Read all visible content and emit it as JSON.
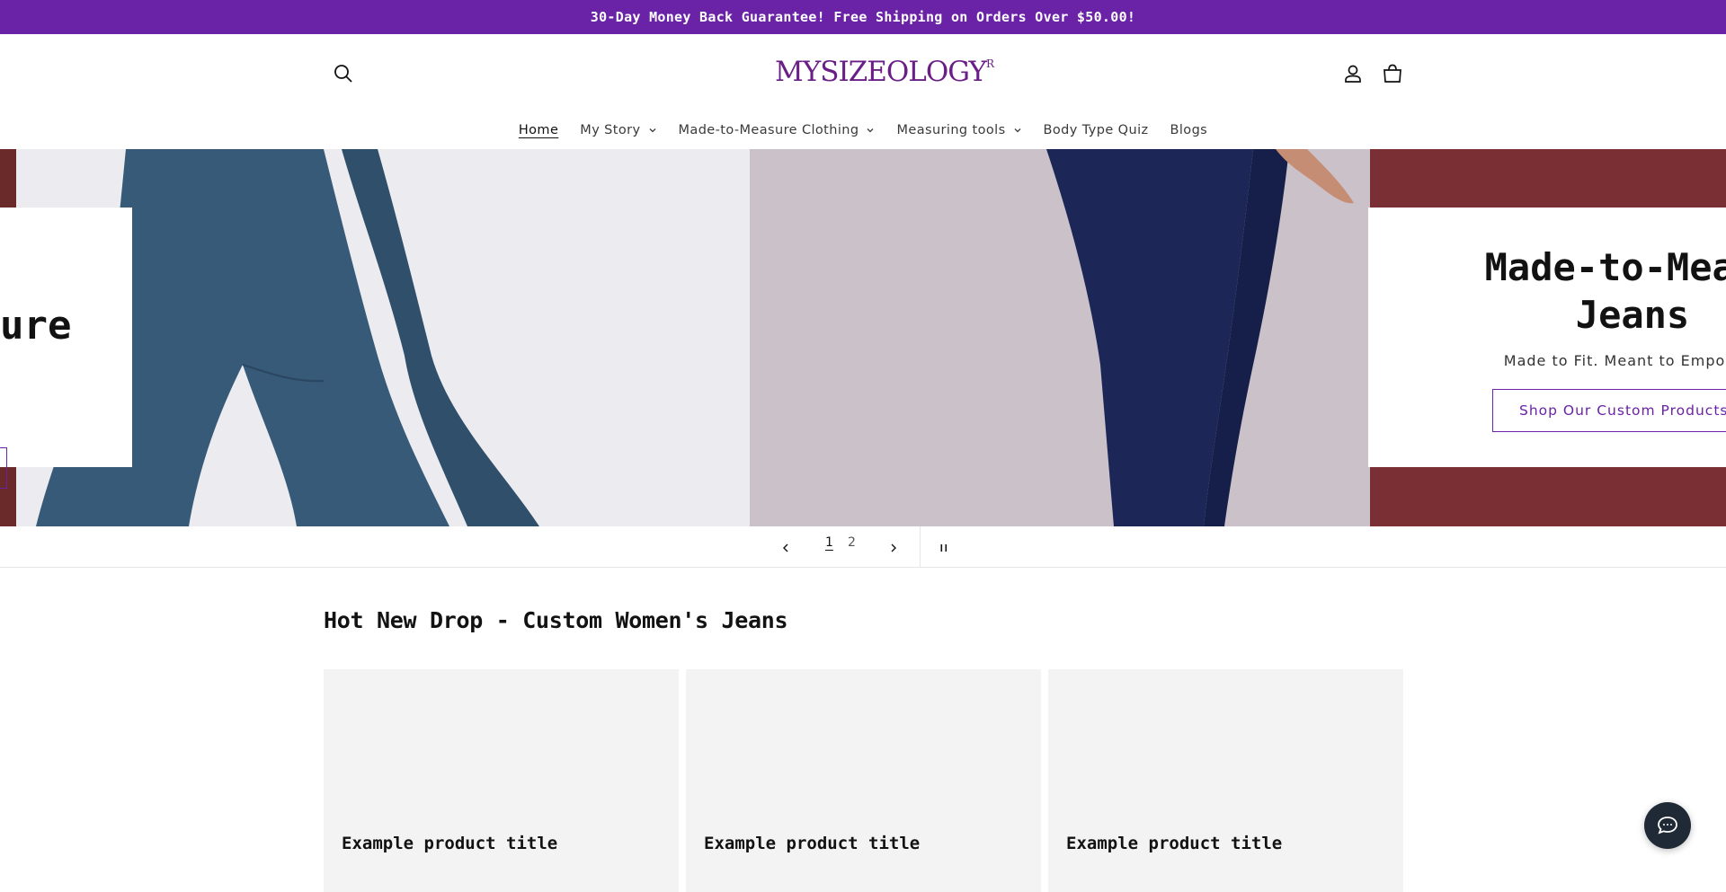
{
  "announcement": {
    "text": "30-Day Money Back Guarantee! Free Shipping on Orders Over $50.00!"
  },
  "header": {
    "logo_text": "MYSIZEOLOGY",
    "logo_mark": "R",
    "icons": {
      "search": "search-icon",
      "account": "account-icon",
      "cart": "cart-icon"
    }
  },
  "nav": {
    "items": [
      {
        "label": "Home",
        "active": true,
        "dropdown": false
      },
      {
        "label": "My Story",
        "active": false,
        "dropdown": true
      },
      {
        "label": "Made-to-Measure Clothing",
        "active": false,
        "dropdown": true
      },
      {
        "label": "Measuring tools",
        "active": false,
        "dropdown": true
      },
      {
        "label": "Body Type Quiz",
        "active": false,
        "dropdown": false
      },
      {
        "label": "Blogs",
        "active": false,
        "dropdown": false
      }
    ]
  },
  "hero": {
    "slide_prev": {
      "heading_fragment": "ure"
    },
    "slide_current": {
      "heading": "Made-to-Measu Jeans",
      "subheading": "Made to Fit. Meant to Empower!",
      "button_label": "Shop Our Custom Products"
    },
    "pagination": {
      "pages": [
        "1",
        "2"
      ],
      "current": "1"
    }
  },
  "collection": {
    "title": "Hot New Drop - Custom Women's Jeans",
    "products": [
      {
        "title": "Example product title"
      },
      {
        "title": "Example product title"
      },
      {
        "title": "Example product title"
      }
    ]
  },
  "colors": {
    "announcement_bg": "#6a22a6",
    "brand_purple": "#6a1f86",
    "card_bg": "#f3f3f3",
    "chat_bg": "#1f2a36"
  }
}
